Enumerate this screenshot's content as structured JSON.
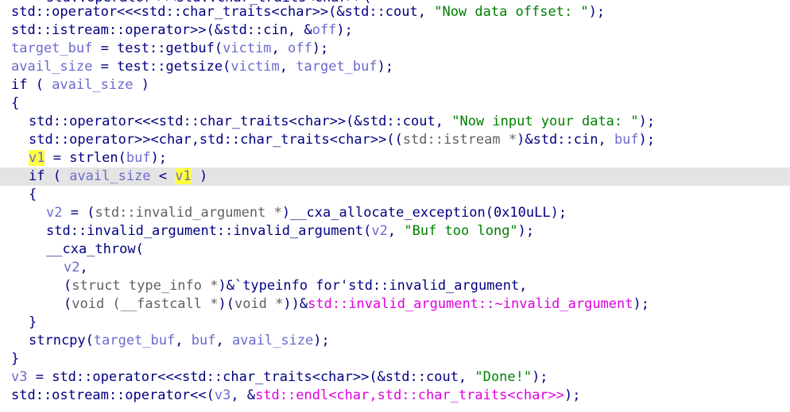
{
  "colors": {
    "default": "#000080",
    "variable": "#6a6acd",
    "gray": "#606060",
    "string": "#008000",
    "import": "#e000e0",
    "highlight_text_bg": "#ffff40",
    "current_line_bg": "#e4e4e4"
  },
  "lines": [
    {
      "indent": 4,
      "highlight": false,
      "tokens": [
        {
          "t": "std::operator<<<std::char_traits<char>>(",
          "c": "n"
        }
      ]
    },
    {
      "indent": 0,
      "highlight": false,
      "tokens": [
        {
          "t": "std::operator<<<std::char_traits<char>>(&std::cout, ",
          "c": "n"
        },
        {
          "t": "\"Now data offset: \"",
          "c": "s"
        },
        {
          "t": ");",
          "c": "n"
        }
      ]
    },
    {
      "indent": 0,
      "highlight": false,
      "tokens": [
        {
          "t": "std::istream::operator>>(&std::cin, &",
          "c": "n"
        },
        {
          "t": "off",
          "c": "v"
        },
        {
          "t": ");",
          "c": "n"
        }
      ]
    },
    {
      "indent": 0,
      "highlight": false,
      "tokens": [
        {
          "t": "target_buf",
          "c": "v"
        },
        {
          "t": " = test::getbuf(",
          "c": "n"
        },
        {
          "t": "victim",
          "c": "v"
        },
        {
          "t": ", ",
          "c": "n"
        },
        {
          "t": "off",
          "c": "v"
        },
        {
          "t": ");",
          "c": "n"
        }
      ]
    },
    {
      "indent": 0,
      "highlight": false,
      "tokens": [
        {
          "t": "avail_size",
          "c": "v"
        },
        {
          "t": " = test::getsize(",
          "c": "n"
        },
        {
          "t": "victim",
          "c": "v"
        },
        {
          "t": ", ",
          "c": "n"
        },
        {
          "t": "target_buf",
          "c": "v"
        },
        {
          "t": ");",
          "c": "n"
        }
      ]
    },
    {
      "indent": 0,
      "highlight": false,
      "tokens": [
        {
          "t": "if ( ",
          "c": "n"
        },
        {
          "t": "avail_size",
          "c": "v"
        },
        {
          "t": " )",
          "c": "n"
        }
      ]
    },
    {
      "indent": 0,
      "highlight": false,
      "tokens": [
        {
          "t": "{",
          "c": "n"
        }
      ]
    },
    {
      "indent": 2,
      "highlight": false,
      "tokens": [
        {
          "t": "std::operator<<<std::char_traits<char>>(&std::cout, ",
          "c": "n"
        },
        {
          "t": "\"Now input your data: \"",
          "c": "s"
        },
        {
          "t": ");",
          "c": "n"
        }
      ]
    },
    {
      "indent": 2,
      "highlight": false,
      "tokens": [
        {
          "t": "std::operator>><char,std::char_traits<char>>((",
          "c": "n"
        },
        {
          "t": "std::istream *",
          "c": "g"
        },
        {
          "t": ")&std::cin, ",
          "c": "n"
        },
        {
          "t": "buf",
          "c": "v"
        },
        {
          "t": ");",
          "c": "n"
        }
      ]
    },
    {
      "indent": 2,
      "highlight": false,
      "tokens": [
        {
          "t": "v1",
          "c": "y"
        },
        {
          "t": " = strlen(",
          "c": "n"
        },
        {
          "t": "buf",
          "c": "v"
        },
        {
          "t": ");",
          "c": "n"
        }
      ]
    },
    {
      "indent": 2,
      "highlight": true,
      "tokens": [
        {
          "t": "if ( ",
          "c": "n"
        },
        {
          "t": "avail_size",
          "c": "v"
        },
        {
          "t": " < ",
          "c": "n"
        },
        {
          "t": "v1",
          "c": "y"
        },
        {
          "t": " )",
          "c": "n"
        }
      ]
    },
    {
      "indent": 2,
      "highlight": false,
      "tokens": [
        {
          "t": "{",
          "c": "n"
        }
      ]
    },
    {
      "indent": 4,
      "highlight": false,
      "tokens": [
        {
          "t": "v2",
          "c": "v"
        },
        {
          "t": " = (",
          "c": "n"
        },
        {
          "t": "std::invalid_argument *",
          "c": "g"
        },
        {
          "t": ")__cxa_allocate_exception(0x10uLL);",
          "c": "n"
        }
      ]
    },
    {
      "indent": 4,
      "highlight": false,
      "tokens": [
        {
          "t": "std::invalid_argument::invalid_argument(",
          "c": "n"
        },
        {
          "t": "v2",
          "c": "v"
        },
        {
          "t": ", ",
          "c": "n"
        },
        {
          "t": "\"Buf too long\"",
          "c": "s"
        },
        {
          "t": ");",
          "c": "n"
        }
      ]
    },
    {
      "indent": 4,
      "highlight": false,
      "tokens": [
        {
          "t": "__cxa_throw(",
          "c": "n"
        }
      ]
    },
    {
      "indent": 6,
      "highlight": false,
      "tokens": [
        {
          "t": "v2",
          "c": "v"
        },
        {
          "t": ",",
          "c": "n"
        }
      ]
    },
    {
      "indent": 6,
      "highlight": false,
      "tokens": [
        {
          "t": "(",
          "c": "n"
        },
        {
          "t": "struct type_info *",
          "c": "g"
        },
        {
          "t": ")&`typeinfo for'std::invalid_argument,",
          "c": "n"
        }
      ]
    },
    {
      "indent": 6,
      "highlight": false,
      "tokens": [
        {
          "t": "(",
          "c": "n"
        },
        {
          "t": "void (__fastcall *",
          "c": "g"
        },
        {
          "t": ")(",
          "c": "n"
        },
        {
          "t": "void *",
          "c": "g"
        },
        {
          "t": "))&",
          "c": "n"
        },
        {
          "t": "std::invalid_argument::~invalid_argument",
          "c": "m"
        },
        {
          "t": ");",
          "c": "n"
        }
      ]
    },
    {
      "indent": 2,
      "highlight": false,
      "tokens": [
        {
          "t": "}",
          "c": "n"
        }
      ]
    },
    {
      "indent": 2,
      "highlight": false,
      "tokens": [
        {
          "t": "strncpy(",
          "c": "n"
        },
        {
          "t": "target_buf",
          "c": "v"
        },
        {
          "t": ", ",
          "c": "n"
        },
        {
          "t": "buf",
          "c": "v"
        },
        {
          "t": ", ",
          "c": "n"
        },
        {
          "t": "avail_size",
          "c": "v"
        },
        {
          "t": ");",
          "c": "n"
        }
      ]
    },
    {
      "indent": 0,
      "highlight": false,
      "tokens": [
        {
          "t": "}",
          "c": "n"
        }
      ]
    },
    {
      "indent": 0,
      "highlight": false,
      "tokens": [
        {
          "t": "v3",
          "c": "v"
        },
        {
          "t": " = std::operator<<<std::char_traits<char>>(&std::cout, ",
          "c": "n"
        },
        {
          "t": "\"Done!\"",
          "c": "s"
        },
        {
          "t": ");",
          "c": "n"
        }
      ]
    },
    {
      "indent": 0,
      "highlight": false,
      "tokens": [
        {
          "t": "std::ostream::operator<<(",
          "c": "n"
        },
        {
          "t": "v3",
          "c": "v"
        },
        {
          "t": ", &",
          "c": "n"
        },
        {
          "t": "std::endl<char,std::char_traits<char>>",
          "c": "m"
        },
        {
          "t": ");",
          "c": "n"
        }
      ]
    }
  ]
}
